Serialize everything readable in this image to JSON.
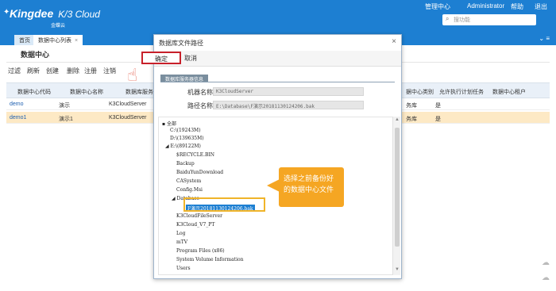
{
  "header": {
    "brand": "Kingdee",
    "product": "K/3 Cloud",
    "brand_sub": "金蝶云",
    "menu": [
      "管理中心",
      "Administrator",
      "帮助",
      "退出"
    ],
    "search_placeholder": "搜功能"
  },
  "tabs": [
    {
      "label": "首页",
      "active": false
    },
    {
      "label": "数据中心列表",
      "active": true
    }
  ],
  "page": {
    "title": "数据中心"
  },
  "toolbar": [
    "过滤",
    "刷新",
    "创建",
    "删除",
    "注册",
    "注销"
  ],
  "grid": {
    "columns": [
      "数据中心代码",
      "数据中心名称",
      "数据库服务",
      "据中心类别",
      "允许执行计划任务",
      "数据中心租户"
    ],
    "rows": [
      {
        "code": "demo",
        "name": "演示",
        "server": "K3CloudServer",
        "category": "务库",
        "allow": "是"
      },
      {
        "code": "demo1",
        "name": "演示1",
        "server": "K3CloudServer",
        "category": "务库",
        "allow": "是"
      }
    ]
  },
  "dialog": {
    "title": "数据库文件路径",
    "ok": "确定",
    "cancel": "取消",
    "section": "数据库服务器信息",
    "server_label": "机器名称",
    "server_value": "K3CloudServer",
    "path_label": "路径名称",
    "path_value": "E:\\Database\\F演示20181130124206.bak",
    "tree": [
      {
        "label": "全部",
        "prefix": "▪"
      },
      {
        "label": "C:\\(19243M)",
        "prefix": ""
      },
      {
        "label": "D:\\(139635M)",
        "prefix": ""
      },
      {
        "label": "E:\\(89122M)",
        "prefix": "◢"
      },
      {
        "label": "$RECYCLE.BIN",
        "prefix": ""
      },
      {
        "label": "Backup",
        "prefix": ""
      },
      {
        "label": "BaiduYunDownload",
        "prefix": ""
      },
      {
        "label": "CASystem",
        "prefix": ""
      },
      {
        "label": "Config.Msi",
        "prefix": ""
      },
      {
        "label": "Database",
        "prefix": "◢"
      },
      {
        "label": "F演示20181130124206.bak",
        "prefix": ""
      },
      {
        "label": "K3CloudFileServer",
        "prefix": ""
      },
      {
        "label": "K3Cloud_V7_PT",
        "prefix": ""
      },
      {
        "label": "Log",
        "prefix": ""
      },
      {
        "label": "mTV",
        "prefix": ""
      },
      {
        "label": "Program Files (x86)",
        "prefix": ""
      },
      {
        "label": "System Volume Information",
        "prefix": ""
      },
      {
        "label": "Users",
        "prefix": ""
      }
    ]
  },
  "callout": {
    "text": "选择之前备份好的数据中心文件"
  },
  "colors": {
    "brand": "#1d7fd2",
    "highlight_row": "#fde9c5",
    "callout": "#f5a623",
    "ok_border": "#c8202a"
  }
}
